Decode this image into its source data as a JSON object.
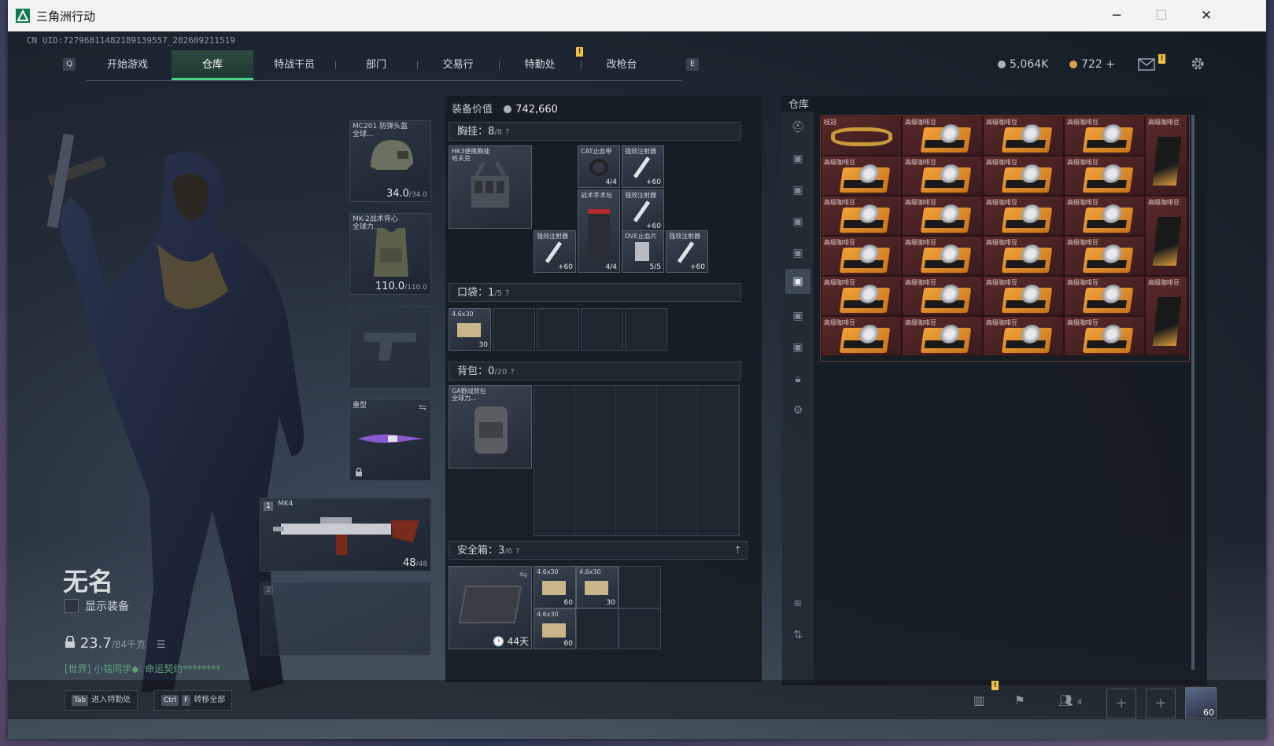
{
  "window": {
    "title": "三角洲行动",
    "min": "─",
    "max": "☐",
    "close": "✕"
  },
  "uid": "CN UID:727968114821891395​57_202609211519",
  "nav": {
    "left_key": "Q",
    "right_key": "E",
    "tabs": [
      "开始游戏",
      "仓库",
      "特战干员",
      "部门",
      "交易行",
      "特勤处",
      "改枪台"
    ],
    "notice": "!"
  },
  "currency": {
    "silver": "5,064K",
    "gold": "722",
    "gold_plus": "+"
  },
  "mail_badge": "!",
  "character": {
    "name": "无名",
    "show_equipment": "显示装备",
    "weight": "23.7",
    "weight_max": "/84千克",
    "chat": "[世界] 小铭同学◆: 命运契约********"
  },
  "equip": {
    "helmet": {
      "label": "MC201 防弹头盔\n全球...",
      "value": "34.0",
      "max": "/34.0"
    },
    "armor": {
      "label": "MK-2战术背心\n全球力...",
      "value": "110.0",
      "max": "/110.0"
    },
    "melee": {
      "label": "重型"
    },
    "primary": {
      "slot": "1",
      "label": "MK4",
      "value": "48",
      "max": "/48"
    },
    "secondary": {
      "slot": "2"
    }
  },
  "loadout": {
    "value_label": "装备价值",
    "value": "742,660",
    "chest": {
      "label": "胸挂：",
      "value": "8",
      "max": "/8",
      "help": "?"
    },
    "chest_rig": "HK3便携胸挂\n哈夫克",
    "chest_items": [
      {
        "label": "CAT止血带",
        "count": "4/4"
      },
      {
        "label": "强效注射器",
        "count": "+60"
      },
      {
        "label": "战术手术包",
        "count": "4/4"
      },
      {
        "label": "强效注射器",
        "count": "+60"
      },
      {
        "label": "强效注射器",
        "count": "+60"
      },
      {
        "label": "DVE止血片",
        "count": "5/5"
      },
      {
        "label": "强效注射器",
        "count": "+60"
      }
    ],
    "pocket": {
      "label": "口袋：",
      "value": "1",
      "max": "/5",
      "help": "?"
    },
    "pocket_item": {
      "label": "4.6x30",
      "count": "30"
    },
    "backpack": {
      "label": "背包：",
      "value": "0",
      "max": "/20",
      "help": "?"
    },
    "backpack_item": "GA野战背包\n全球力...",
    "safebox": {
      "label": "安全箱：",
      "value": "3",
      "max": "/6",
      "help": "?",
      "timer": "44天"
    },
    "safe_items": [
      {
        "label": "4.6x30",
        "count": "60"
      },
      {
        "label": "4.6x30",
        "count": "30"
      },
      {
        "label": "4.6x30",
        "count": "60"
      }
    ]
  },
  "stash": {
    "title": "仓库",
    "first_label": "枝冠",
    "item_label": "高级咖啡豆",
    "side_icons": [
      "helmet-icon",
      "bag-icon",
      "bag-icon",
      "bag-icon",
      "bag-icon",
      "bag-icon",
      "bag-icon",
      "bag-icon",
      "lock-icon",
      "gear-icon"
    ]
  },
  "bottom": {
    "hint1_key": "Tab",
    "hint1": "进入特勤处",
    "hint2_key1": "Ctrl",
    "hint2_key2": "F",
    "hint2": "转移全部",
    "friends": "4",
    "level": "60",
    "badge": "!"
  }
}
